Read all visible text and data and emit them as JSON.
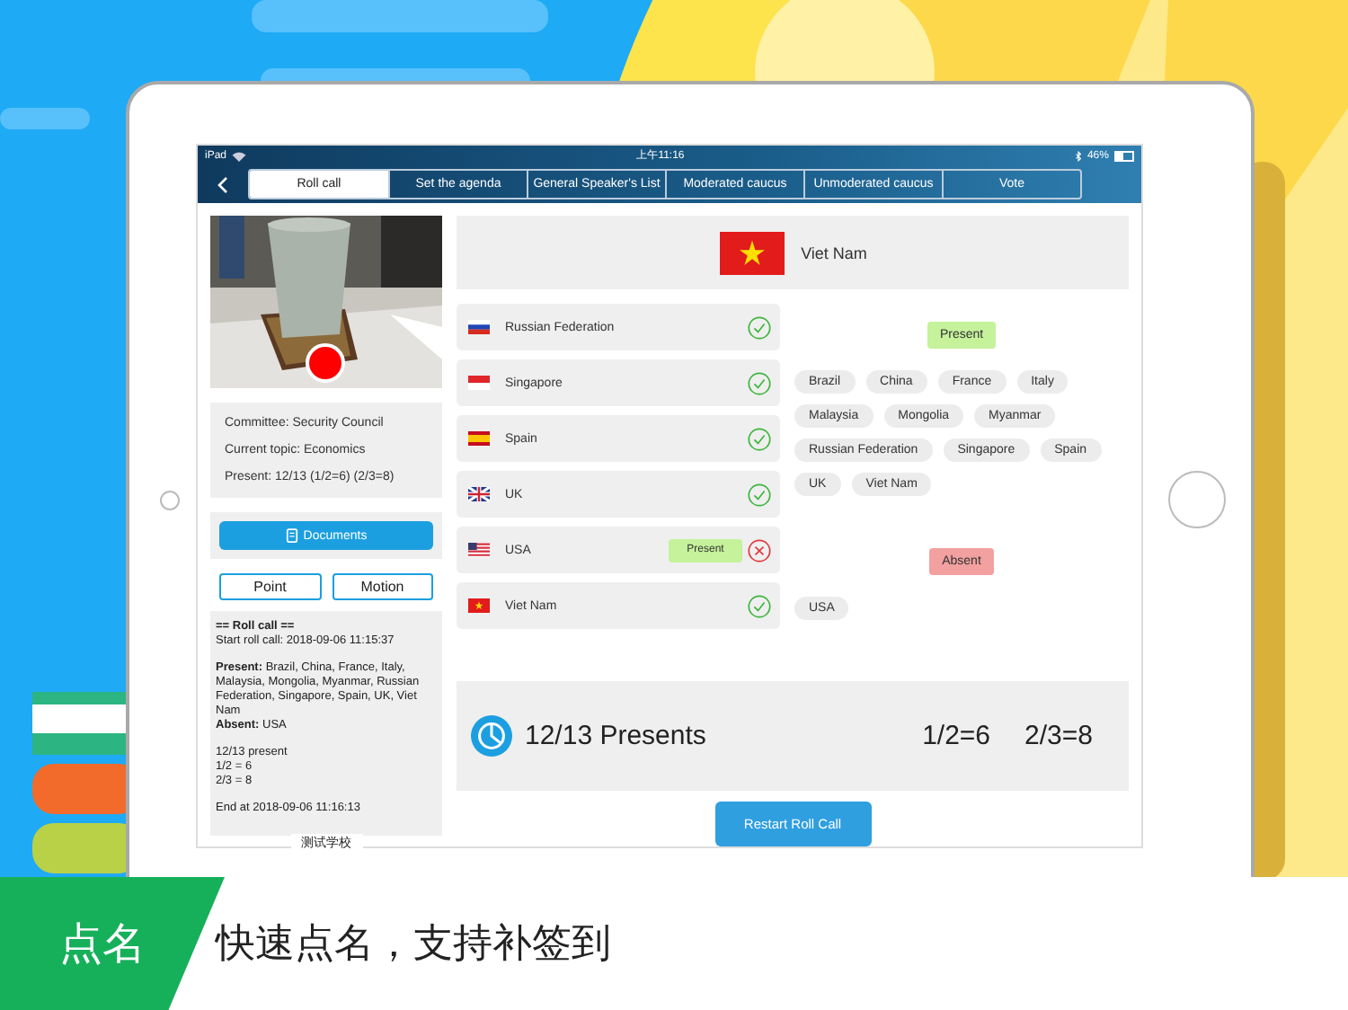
{
  "status_bar": {
    "device": "iPad",
    "time": "上午11:16",
    "battery": "46%"
  },
  "tabs": [
    {
      "label": "Roll call",
      "selected": true
    },
    {
      "label": "Set the agenda",
      "selected": false
    },
    {
      "label": "General Speaker's List",
      "selected": false
    },
    {
      "label": "Moderated caucus",
      "selected": false
    },
    {
      "label": "Unmoderated caucus",
      "selected": false
    },
    {
      "label": "Vote",
      "selected": false
    }
  ],
  "session": {
    "lines": [
      "Committee: Security Council",
      "Current topic: Economics",
      "Present: 12/13 (1/2=6) (2/3=8)"
    ]
  },
  "documents_button": "Documents",
  "action_buttons": [
    "Point",
    "Motion"
  ],
  "log": [
    {
      "lines": [
        {
          "text": "== Roll call ==",
          "bold": true
        },
        {
          "text": "Start roll call: 2018-09-06 11:15:37",
          "bold": false
        }
      ]
    },
    {
      "lines": [
        {
          "text": "**Present:** Brazil, China, France, Italy, Malaysia, Mongolia, Myanmar, Russian Federation, Singapore, Spain, UK, Viet Nam",
          "bold": false
        },
        {
          "text": "**Absent:** USA",
          "bold": false
        }
      ]
    },
    {
      "lines": [
        {
          "text": "12/13 present",
          "bold": false
        },
        {
          "text": "1/2 = 6",
          "bold": false
        },
        {
          "text": "2/3 = 8",
          "bold": false
        }
      ]
    },
    {
      "lines": [
        {
          "text": "End at 2018-09-06 11:16:13",
          "bold": false
        }
      ]
    }
  ],
  "school": "测试学校",
  "current_country": {
    "name": "Viet Nam",
    "kind": "vietnam"
  },
  "roll": [
    {
      "name": "Russian Federation",
      "kind": "russia",
      "present": true
    },
    {
      "name": "Singapore",
      "kind": "singapore",
      "present": true
    },
    {
      "name": "Spain",
      "kind": "spain",
      "present": true
    },
    {
      "name": "UK",
      "kind": "uk",
      "present": true
    },
    {
      "name": "USA",
      "kind": "usa",
      "present": false,
      "action": "Present"
    },
    {
      "name": "Viet Nam",
      "kind": "vietnam",
      "present": true
    }
  ],
  "groups": [
    {
      "label": "Present",
      "kind": "present",
      "members": [
        "Brazil",
        "China",
        "France",
        "Italy",
        "Malaysia",
        "Mongolia",
        "Myanmar",
        "Russian Federation",
        "Singapore",
        "Spain",
        "UK",
        "Viet Nam"
      ]
    },
    {
      "label": "Absent",
      "kind": "absent",
      "members": [
        "USA"
      ]
    }
  ],
  "summary": {
    "presents": "12/13  Presents",
    "half": "1/2=6",
    "two_thirds": "2/3=8"
  },
  "restart_button": "Restart Roll Call",
  "banner": {
    "tag": "点名",
    "caption": "快速点名，支持补签到"
  }
}
